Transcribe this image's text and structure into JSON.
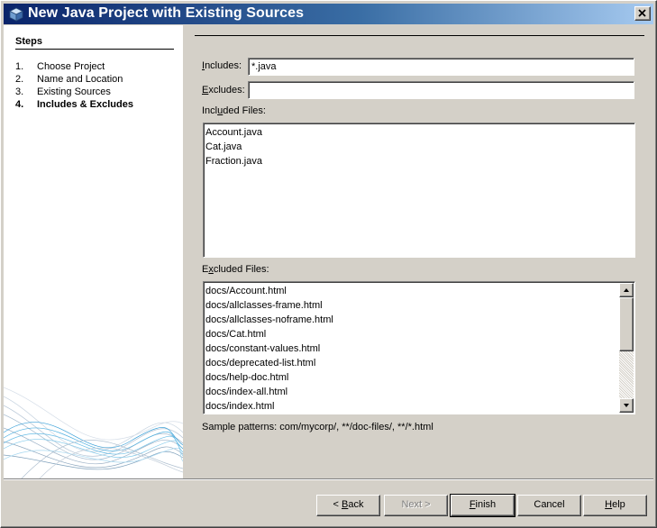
{
  "window": {
    "title": "New Java Project with Existing Sources",
    "icon": "java-project-cube-icon"
  },
  "steps": {
    "title": "Steps",
    "items": [
      {
        "num": "1.",
        "label": "Choose Project"
      },
      {
        "num": "2.",
        "label": "Name and Location"
      },
      {
        "num": "3.",
        "label": "Existing Sources"
      },
      {
        "num": "4.",
        "label": "Includes & Excludes"
      }
    ],
    "current_index": 3
  },
  "includes": {
    "label_prefix": "",
    "label_mnemonic": "I",
    "label_rest": "ncludes:",
    "value": "*.java"
  },
  "excludes": {
    "label_prefix": "",
    "label_mnemonic": "E",
    "label_rest": "xcludes:",
    "value": ""
  },
  "included_files": {
    "label_prefix": "Incl",
    "label_mnemonic": "u",
    "label_rest": "ded Files:",
    "items": [
      "Account.java",
      "Cat.java",
      "Fraction.java"
    ]
  },
  "excluded_files": {
    "label_prefix": "E",
    "label_mnemonic": "x",
    "label_rest": "cluded Files:",
    "items": [
      "docs/Account.html",
      "docs/allclasses-frame.html",
      "docs/allclasses-noframe.html",
      "docs/Cat.html",
      "docs/constant-values.html",
      "docs/deprecated-list.html",
      "docs/help-doc.html",
      "docs/index-all.html",
      "docs/index.html"
    ]
  },
  "sample_patterns": "Sample patterns: com/mycorp/, **/doc-files/, **/*.html",
  "buttons": {
    "back": {
      "prefix": "< ",
      "mnemonic": "B",
      "rest": "ack"
    },
    "next": {
      "label": "Next >"
    },
    "finish": {
      "prefix": "",
      "mnemonic": "F",
      "rest": "inish"
    },
    "cancel": {
      "label": "Cancel"
    },
    "help": {
      "prefix": "",
      "mnemonic": "H",
      "rest": "elp"
    }
  },
  "colors": {
    "titlebar_start": "#0a246a",
    "titlebar_end": "#a6caf0",
    "dialog_face": "#d4d0c8",
    "wave_accent": "#3aa0d8"
  }
}
